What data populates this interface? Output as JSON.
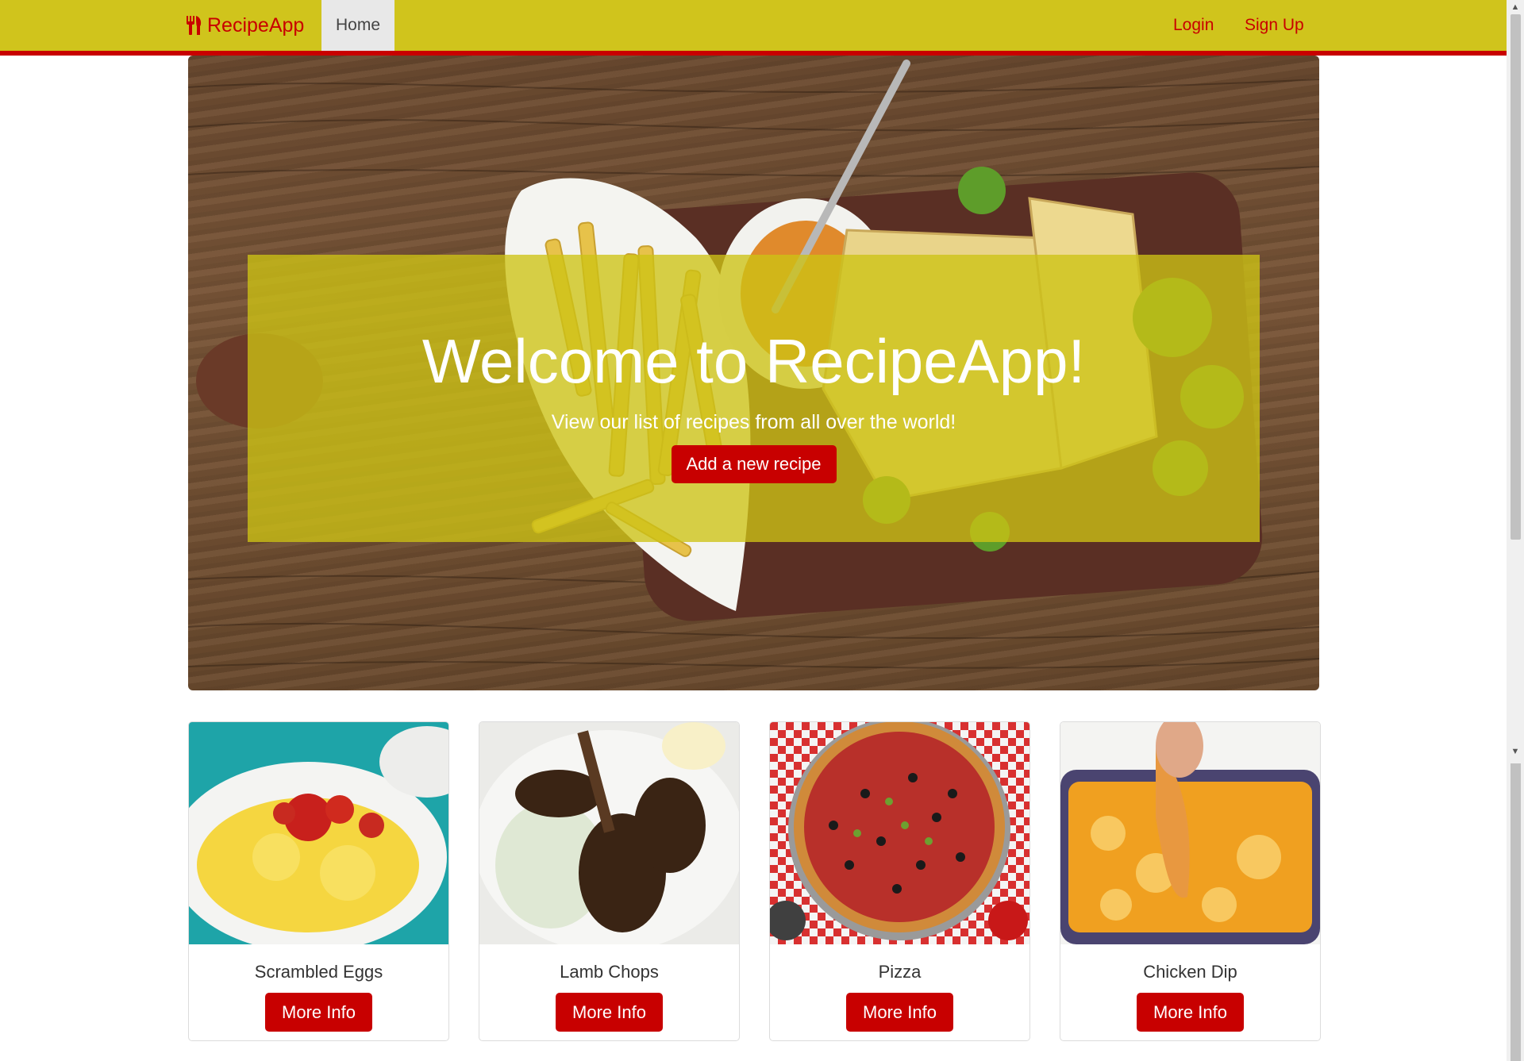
{
  "navbar": {
    "brand": "RecipeApp",
    "home": "Home",
    "login": "Login",
    "signup": "Sign Up"
  },
  "hero": {
    "title": "Welcome to RecipeApp!",
    "subtitle": "View our list of recipes from all over the world!",
    "button": "Add a new recipe"
  },
  "cards": [
    {
      "title": "Scrambled Eggs",
      "button": "More Info"
    },
    {
      "title": "Lamb Chops",
      "button": "More Info"
    },
    {
      "title": "Pizza",
      "button": "More Info"
    },
    {
      "title": "Chicken Dip",
      "button": "More Info"
    }
  ],
  "colors": {
    "navbar": "#d0c41c",
    "accent": "#c80000",
    "panel": "#cdc314"
  },
  "icons": {
    "brand": "utensils-icon"
  }
}
